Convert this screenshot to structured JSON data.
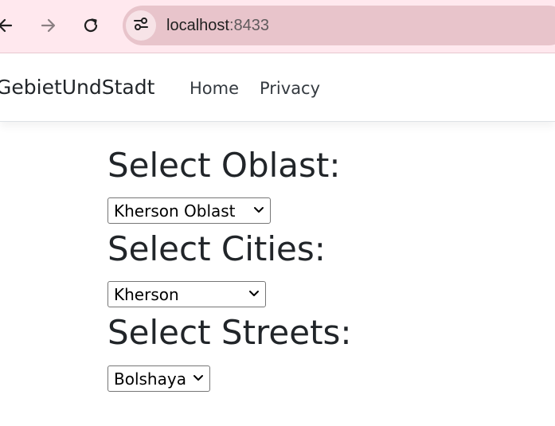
{
  "browser": {
    "url_host": "localhost",
    "url_port": ":8433",
    "icons": {
      "back": "arrow-left-icon",
      "forward": "arrow-right-icon",
      "reload": "reload-icon",
      "site_info": "site-settings-icon"
    }
  },
  "navbar": {
    "brand": "GebietUndStadt",
    "links": [
      {
        "label": "Home"
      },
      {
        "label": "Privacy"
      }
    ]
  },
  "form": {
    "oblast": {
      "heading": "Select Oblast:",
      "selected": "Kherson Oblast"
    },
    "cities": {
      "heading": "Select Cities:",
      "selected": "Kherson"
    },
    "streets": {
      "heading": "Select Streets:",
      "selected": "Bolshaya"
    }
  },
  "colors": {
    "chrome_bg": "#ffe8ee",
    "omnibox_bg": "#e8c4cb",
    "text": "#212529"
  }
}
